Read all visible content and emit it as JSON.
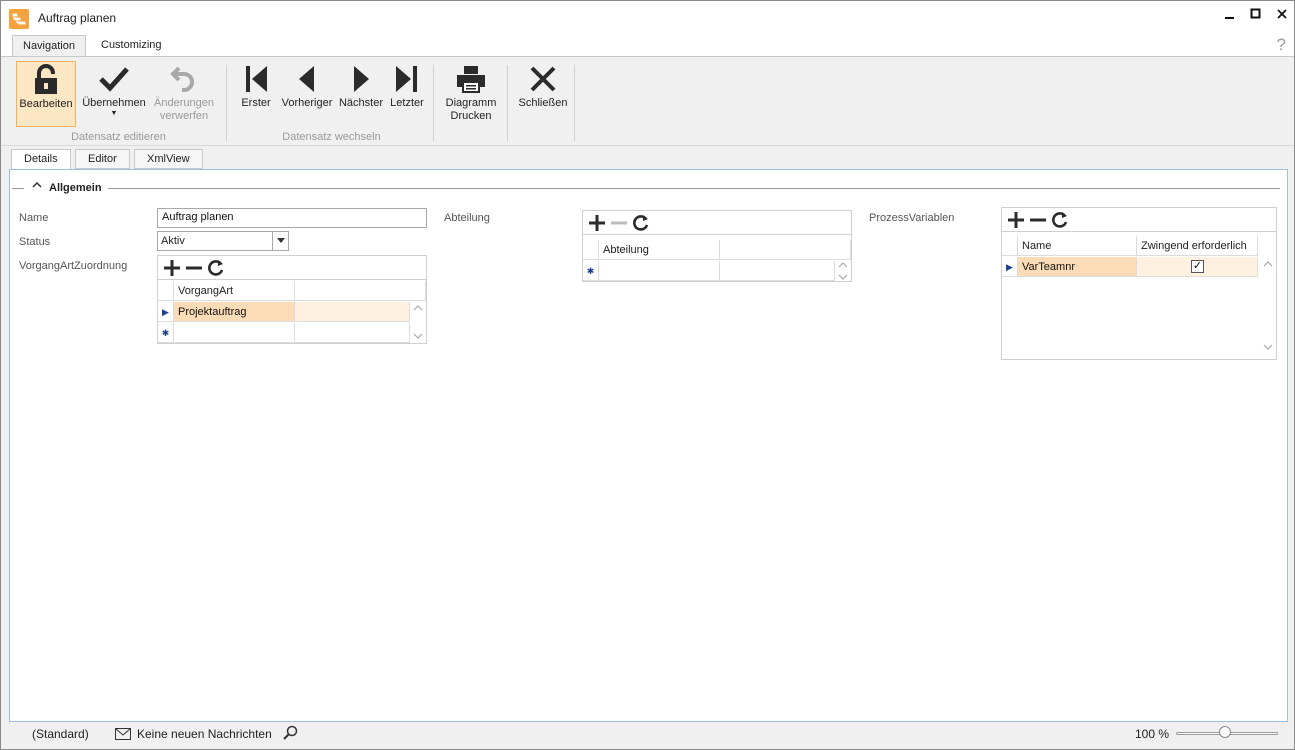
{
  "window": {
    "title": "Auftrag planen",
    "minimize_icon": "minimize-icon",
    "maximize_icon": "maximize-icon",
    "close_icon": "close-icon"
  },
  "ribbon_tabs": [
    {
      "label": "Navigation",
      "active": true
    },
    {
      "label": "Customizing",
      "active": false
    }
  ],
  "help_glyph": "?",
  "ribbon": {
    "groups": [
      {
        "label": "Datensatz editieren"
      },
      {
        "label": "Datensatz wechseln"
      }
    ],
    "buttons": {
      "edit": {
        "label": "Bearbeiten",
        "icon": "unlock-icon"
      },
      "apply": {
        "label": "Übernehmen",
        "icon": "checkmark-icon"
      },
      "discard_line1": "Änderungen",
      "discard_line2": "verwerfen",
      "first": {
        "label": "Erster",
        "icon": "first-record-icon"
      },
      "prev": {
        "label": "Vorheriger",
        "icon": "previous-icon"
      },
      "next": {
        "label": "Nächster",
        "icon": "next-icon"
      },
      "last": {
        "label": "Letzter",
        "icon": "last-record-icon"
      },
      "print_line1": "Diagramm",
      "print_line2": "Drucken",
      "close": {
        "label": "Schließen",
        "icon": "close-icon"
      }
    }
  },
  "content_tabs": [
    {
      "label": "Details",
      "active": true
    },
    {
      "label": "Editor",
      "active": false
    },
    {
      "label": "XmlView",
      "active": false
    }
  ],
  "group": {
    "title": "Allgemein"
  },
  "form": {
    "name_label": "Name",
    "name_value": "Auftrag planen",
    "status_label": "Status",
    "status_value": "Aktiv",
    "vorgang_label": "VorgangArtZuordnung",
    "abteilung_label": "Abteilung",
    "prozess_label": "ProzessVariablen"
  },
  "grid_vorgang": {
    "column": "VorgangArt",
    "rows": [
      "Projektauftrag"
    ]
  },
  "grid_abteilung": {
    "column": "Abteilung"
  },
  "grid_prozess": {
    "columns": [
      "Name",
      "Zwingend erforderlich"
    ],
    "rows": [
      {
        "name": "VarTeamnr",
        "required": true
      }
    ]
  },
  "status": {
    "layout": "(Standard)",
    "messages": "Keine neuen Nachrichten",
    "zoom": "100 %",
    "zoom_level": 1.0
  },
  "colors": {
    "accent": "#f4a340",
    "selection": "#fcdcb6",
    "border_blue": "#9bbfe0"
  }
}
